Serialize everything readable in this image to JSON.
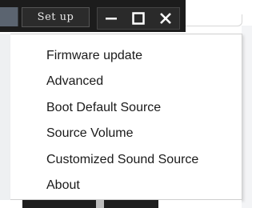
{
  "toolbar": {
    "setup_label": "Set up"
  },
  "window_controls": {
    "minimize_icon": "minimize-icon",
    "maximize_icon": "maximize-icon",
    "close_icon": "close-icon"
  },
  "menu": {
    "items": [
      {
        "label": "Firmware update"
      },
      {
        "label": "Advanced"
      },
      {
        "label": "Boot Default Source"
      },
      {
        "label": "Source Volume"
      },
      {
        "label": "Customized Sound Source"
      },
      {
        "label": "About"
      }
    ]
  },
  "colors": {
    "titlebar_bg": "#1c1c1c",
    "menu_bg": "#ffffff",
    "menu_text": "#1a1a1a",
    "icon_color": "#ffffff"
  }
}
